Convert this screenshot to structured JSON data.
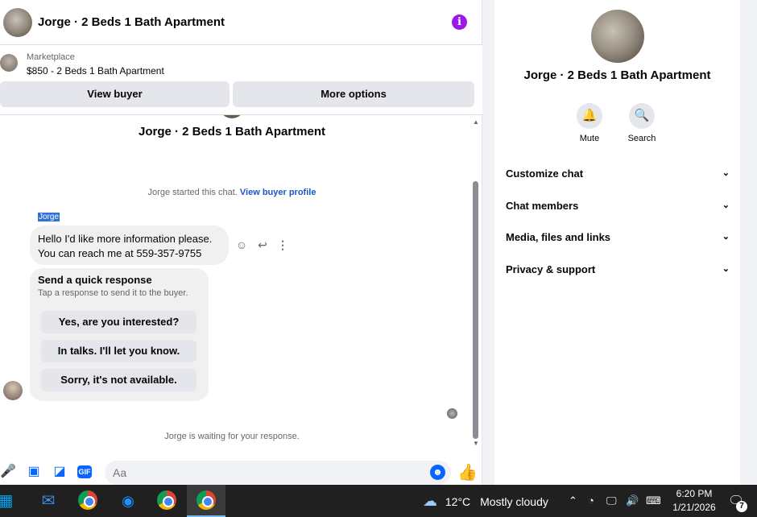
{
  "header": {
    "title": "Jorge · 2 Beds 1 Bath Apartment",
    "info_icon": "info-icon",
    "accent": "#9b18e8"
  },
  "listing": {
    "label": "Marketplace",
    "price_title": "$850 - 2 Beds 1 Bath Apartment",
    "view_buyer": "View buyer",
    "more_options": "More options"
  },
  "conversation": {
    "title": "Jorge · 2 Beds 1 Bath Apartment",
    "started_text": "Jorge started this chat.",
    "started_link": "View buyer profile",
    "sender": "Jorge",
    "message_line1": "Hello I'd like more information please.",
    "message_line2": "You can reach me at 559-357-9755",
    "quick_title": "Send a quick response",
    "quick_sub": "Tap a response to send it to the buyer.",
    "quick_options": [
      "Yes, are you interested?",
      "In talks. I'll let you know.",
      "Sorry, it's not available."
    ],
    "waiting": "Jorge is waiting for your response."
  },
  "composer": {
    "placeholder": "Aa",
    "icons": [
      "microphone-icon",
      "photo-icon",
      "sticker-icon",
      "gif-icon",
      "emoji-icon",
      "thumbs-up-icon"
    ],
    "gif_label": "GIF"
  },
  "panel": {
    "title": "Jorge · 2 Beds 1 Bath Apartment",
    "mute": "Mute",
    "search": "Search",
    "rows": [
      "Customize chat",
      "Chat members",
      "Media, files and links",
      "Privacy & support"
    ]
  },
  "taskbar": {
    "temperature": "12°C",
    "weather": "Mostly cloudy",
    "time": "6:20 PM",
    "date": "1/21/2026",
    "notifications": "7"
  }
}
